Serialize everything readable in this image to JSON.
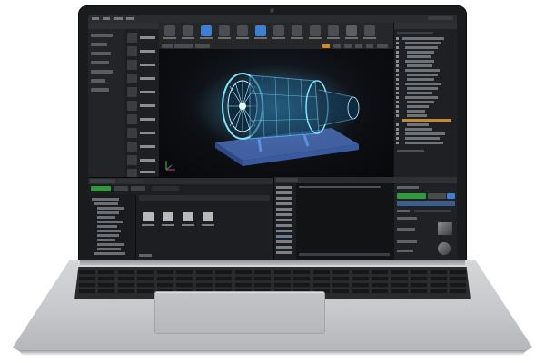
{
  "image": {
    "subject": "laptop",
    "screen_app": "3d-game-engine-editor",
    "viewport_content": "turbofan-engine-wireframe",
    "colors": {
      "body_silver": "#c6c8cb",
      "bezel": "#1a1b1d",
      "editor_dark": "#1e1f22",
      "accent_blue": "#3d7fd0",
      "accent_green": "#2e9a3c",
      "accent_orange": "#d4892a",
      "hologram_cyan": "#4fd0ff"
    },
    "icons": [
      "hp-logo-icon",
      "camera-icon",
      "turbine-icon",
      "folder-icon"
    ]
  }
}
